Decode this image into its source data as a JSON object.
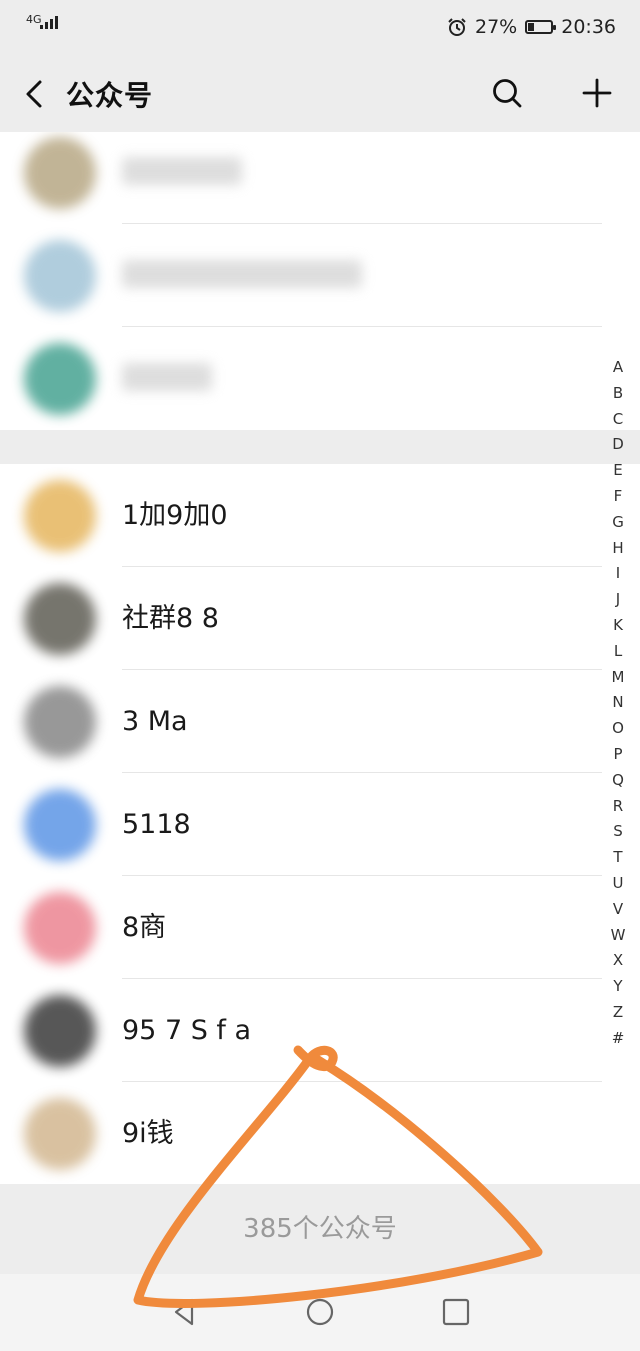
{
  "status": {
    "network": "4G",
    "alarm_icon": "alarm-icon",
    "battery": "27%",
    "battery_level": 0.27,
    "time": "20:36"
  },
  "header": {
    "title": "公众号",
    "back_icon": "chevron-left-icon",
    "search_icon": "search-icon",
    "add_icon": "plus-icon"
  },
  "rows_top": [
    {
      "name": "",
      "avatar_color": "#a8956a"
    },
    {
      "name": "",
      "avatar_color": "#8fb8cf"
    },
    {
      "name": "",
      "avatar_color": "#1f8f7a"
    }
  ],
  "section": {
    "label": ""
  },
  "rows": [
    {
      "name": "1加9加0",
      "avatar_color": "#e0a63c"
    },
    {
      "name": "社群8 8",
      "avatar_color": "#3d3b30"
    },
    {
      "name": "3 Ma",
      "avatar_color": "#6d6d6d"
    },
    {
      "name": "5118",
      "avatar_color": "#3a7fe0"
    },
    {
      "name": "8商",
      "avatar_color": "#e86b7a"
    },
    {
      "name": "95 7 S f a",
      "avatar_color": "#111111"
    },
    {
      "name": "9i钱",
      "avatar_color": "#c9a879"
    }
  ],
  "index_letters": [
    "A",
    "B",
    "C",
    "D",
    "E",
    "F",
    "G",
    "H",
    "I",
    "J",
    "K",
    "L",
    "M",
    "N",
    "O",
    "P",
    "Q",
    "R",
    "S",
    "T",
    "U",
    "V",
    "W",
    "X",
    "Y",
    "Z",
    "#"
  ],
  "footer": {
    "count_label": "385个公众号"
  },
  "annotation_color": "#f08a3c"
}
